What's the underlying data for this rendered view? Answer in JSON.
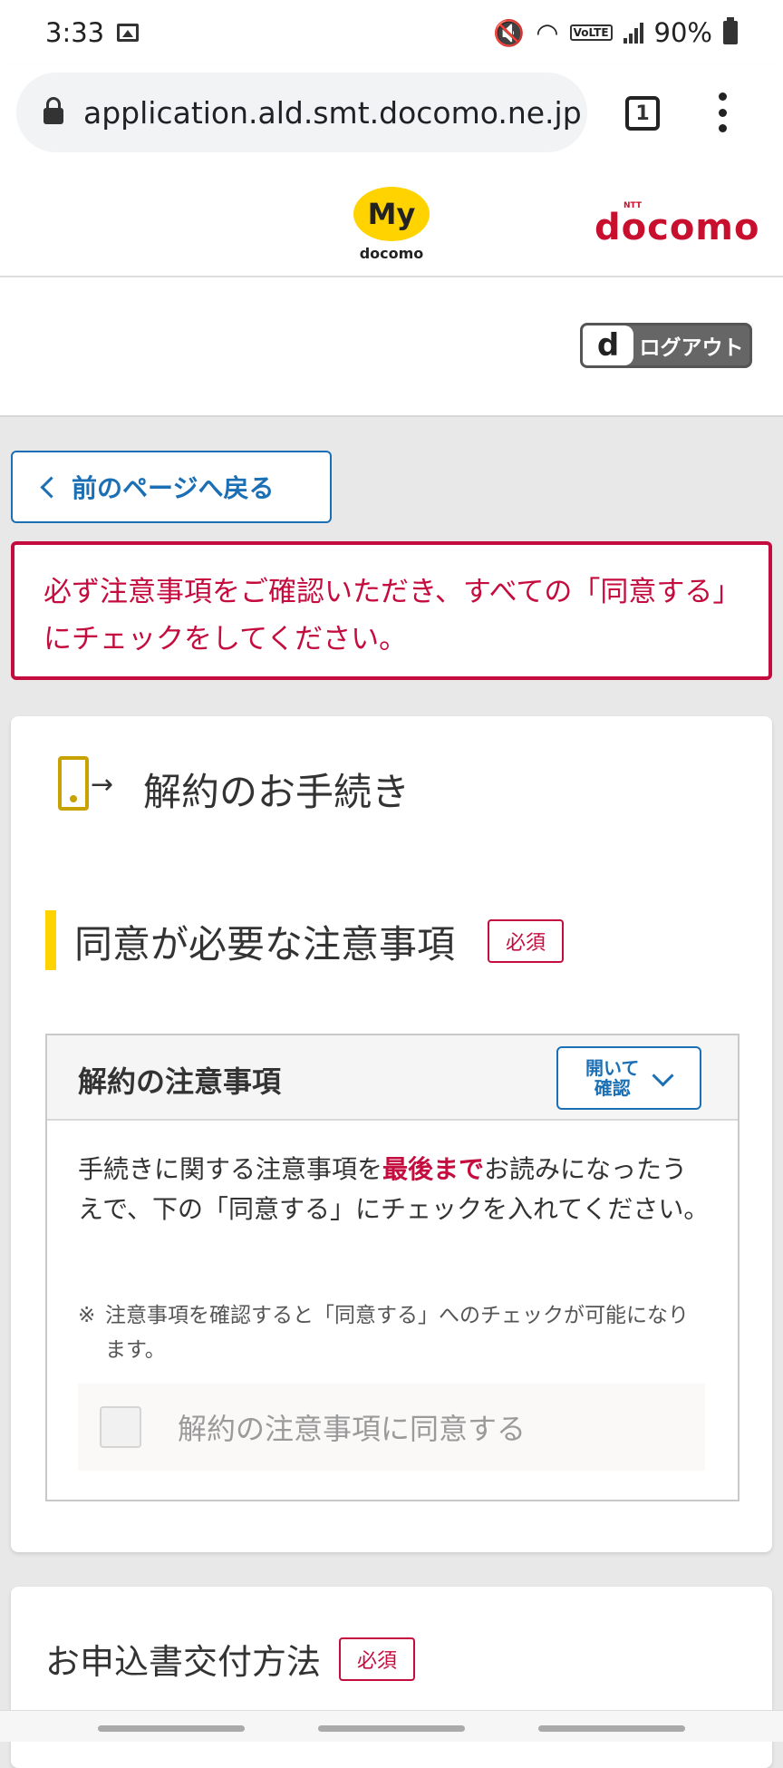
{
  "status_bar": {
    "time": "3:33",
    "battery": "90%"
  },
  "browser": {
    "url": "application.ald.smt.docomo.ne.jp",
    "tab_count": "1"
  },
  "header": {
    "my_logo_main": "My",
    "my_logo_sub": "docomo",
    "brand_small": "NTT",
    "brand": "docomo"
  },
  "logout": {
    "icon_letter": "d",
    "label": "ログアウト"
  },
  "back_button": {
    "label": "前のページへ戻る"
  },
  "alert": {
    "message": "必ず注意事項をご確認いただき、すべての「同意する」にチェックをしてください。"
  },
  "procedure": {
    "title": "解約のお手続き"
  },
  "section": {
    "title": "同意が必要な注意事項",
    "required_badge": "必須"
  },
  "notice": {
    "title": "解約の注意事項",
    "open_line1": "開いて",
    "open_line2": "確認",
    "body_pre": "手続きに関する注意事項を",
    "body_emph": "最後まで",
    "body_post": "お読みになったうえで、下の「同意する」にチェックを入れてください。",
    "note_mark": "※",
    "note": "注意事項を確認すると「同意する」へのチェックが可能になります。",
    "agree_label": "解約の注意事項に同意する"
  },
  "delivery": {
    "title": "お申込書交付方法",
    "required_badge": "必須"
  }
}
